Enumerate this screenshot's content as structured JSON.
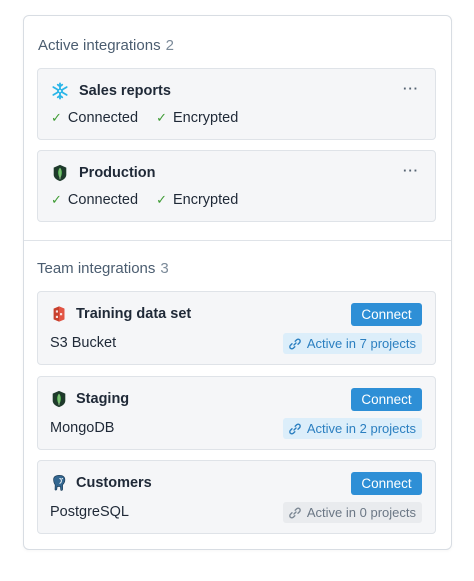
{
  "active_section": {
    "title": "Active integrations",
    "count": "2",
    "cards": [
      {
        "title": "Sales reports",
        "icon": "snowflake-icon",
        "statuses": [
          "Connected",
          "Encrypted"
        ],
        "more": "···"
      },
      {
        "title": "Production",
        "icon": "mongodb-leaf-icon",
        "statuses": [
          "Connected",
          "Encrypted"
        ],
        "more": "···"
      }
    ]
  },
  "team_section": {
    "title": "Team integrations",
    "count": "3",
    "cards": [
      {
        "title": "Training data set",
        "icon": "aws-s3-icon",
        "type": "S3 Bucket",
        "button": "Connect",
        "badge": "Active in 7 projects"
      },
      {
        "title": "Staging",
        "icon": "mongodb-leaf-icon",
        "type": "MongoDB",
        "button": "Connect",
        "badge": "Active in 2 projects"
      },
      {
        "title": "Customers",
        "icon": "postgresql-elephant-icon",
        "type": "PostgreSQL",
        "button": "Connect",
        "badge": "Active in 0 projects"
      }
    ]
  },
  "colors": {
    "accent": "#2e8fd6",
    "check_green": "#3f9c35",
    "badge_blue_bg": "#dceefa",
    "badge_grey_bg": "#e9ebee"
  }
}
